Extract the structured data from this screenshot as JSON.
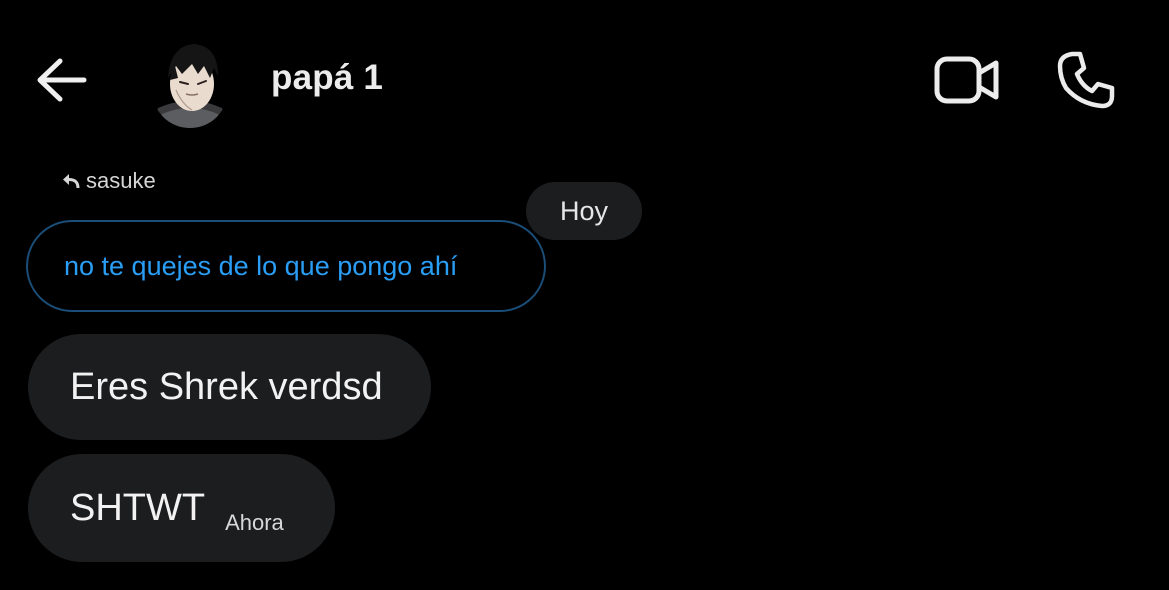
{
  "header": {
    "back_icon": "arrow-left-icon",
    "contact_name": "papá 1",
    "avatar_icon": "profile-avatar",
    "video_icon": "video-camera-icon",
    "call_icon": "phone-icon"
  },
  "thread": {
    "reply_label": "sasuke",
    "reply_icon": "reply-arrow-icon",
    "date_label": "Hoy",
    "quoted_message": "no te quejes de lo que pongo ahí",
    "messages": [
      {
        "text": "Eres Shrek verdsd",
        "time": ""
      },
      {
        "text": "SHTWT",
        "time": "Ahora"
      }
    ]
  },
  "colors": {
    "background": "#000000",
    "bubble": "#1c1d1f",
    "accent_link": "#2a9df4",
    "quote_border": "#1a4d77",
    "text_primary": "#f2f2f2"
  }
}
